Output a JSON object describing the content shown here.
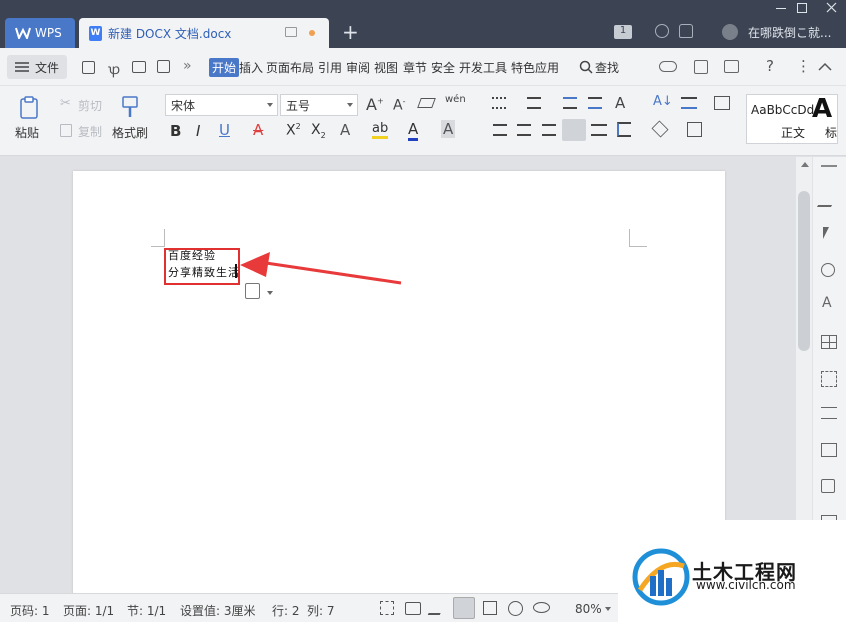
{
  "titlebar": {
    "app_tab": "WPS",
    "doc_tab": "新建 DOCX 文档.docx",
    "doc_tab_icon": "W",
    "new_tab": "+",
    "badge": "1",
    "search_hint": "在哪跌倒こ就..."
  },
  "menubar": {
    "file_label": "文件",
    "tabs": [
      "开始",
      "插入",
      "页面布局",
      "引用",
      "审阅",
      "视图",
      "章节",
      "安全",
      "开发工具",
      "特色应用"
    ],
    "search_label": "查找"
  },
  "ribbon": {
    "paste": "粘贴",
    "cut": "剪切",
    "copy": "复制",
    "format_painter": "格式刷",
    "font_name": "宋体",
    "font_size": "五号",
    "style_preview": "AaBbCcDd",
    "style_name": "正文",
    "style_big": "A",
    "style_big_label": "标"
  },
  "document": {
    "lines": [
      "百度经验",
      "分享精致生活"
    ]
  },
  "status": {
    "page_no": "页码: 1",
    "pages": "页面: 1/1",
    "section": "节: 1/1",
    "setting": "设置值: 3厘米",
    "row": "行: 2",
    "col": "列: 7",
    "zoom": "80%"
  },
  "watermark": {
    "title": "土木工程网",
    "url": "www.civilcn.com"
  },
  "colors": {
    "accent": "#4a78c8",
    "highlight_box": "#e03030",
    "arrow": "#e83a3a"
  }
}
